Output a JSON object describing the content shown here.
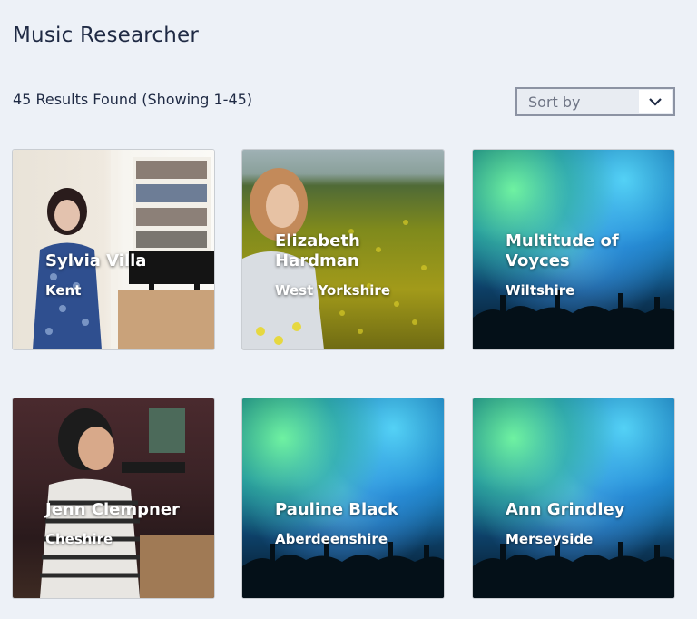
{
  "header": {
    "title": "Music Researcher",
    "results_text": "45 Results Found (Showing 1-45)"
  },
  "sort": {
    "label": "Sort by",
    "icon": "chevron-down-icon"
  },
  "cards": [
    {
      "name": "Sylvia Villa",
      "location": "Kent",
      "image": "woman-in-library"
    },
    {
      "name": "Elizabeth Hardman",
      "location": "West Yorkshire",
      "image": "woman-in-field"
    },
    {
      "name": "Multitude of Voyces",
      "location": "Wiltshire",
      "image": "concert-crowd"
    },
    {
      "name": "Jenn Clempner",
      "location": "Cheshire",
      "image": "woman-with-microphone"
    },
    {
      "name": "Pauline Black",
      "location": "Aberdeenshire",
      "image": "concert-crowd"
    },
    {
      "name": "Ann Grindley",
      "location": "Merseyside",
      "image": "concert-crowd"
    }
  ]
}
